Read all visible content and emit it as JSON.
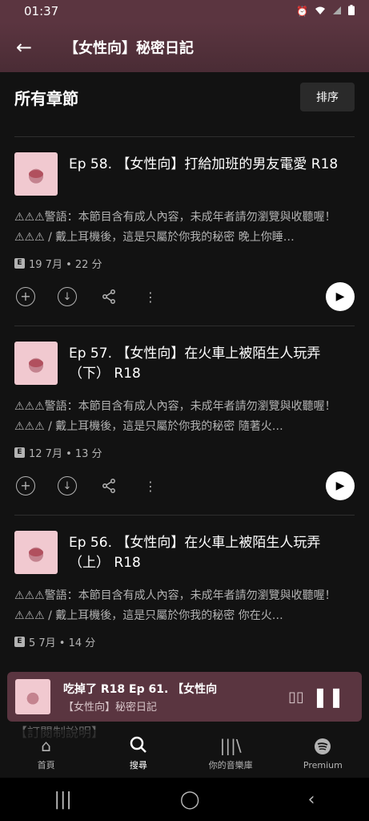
{
  "status": {
    "time": "01:37",
    "icons": [
      "alarm-icon",
      "wifi-icon",
      "signal-icon",
      "battery-icon"
    ]
  },
  "header": {
    "title": "【女性向】秘密日記"
  },
  "section": {
    "title": "所有章節",
    "sort_label": "排序"
  },
  "episodes": [
    {
      "title": "Ep 58. 【女性向】打給加班的男友電愛 R18",
      "description": "⚠⚠⚠警語：本節目含有成人內容，未成年者請勿瀏覽與收聽喔！⚠⚠⚠ / 戴上耳機後，這是只屬於你我的秘密 晚上你睡…",
      "explicit": "E",
      "meta": "19 7月 • 22 分"
    },
    {
      "title": "Ep 57. 【女性向】在火車上被陌生人玩弄（下） R18",
      "description": "⚠⚠⚠警語：本節目含有成人內容，未成年者請勿瀏覽與收聽喔！⚠⚠⚠ / 戴上耳機後，這是只屬於你我的秘密 隨著火…",
      "explicit": "E",
      "meta": "12 7月 • 13 分"
    },
    {
      "title": "Ep 56. 【女性向】在火車上被陌生人玩弄（上） R18",
      "description": "⚠⚠⚠警語：本節目含有成人內容，未成年者請勿瀏覽與收聽喔！⚠⚠⚠ / 戴上耳機後，這是只屬於你我的秘密 你在火…",
      "explicit": "E",
      "meta": "5 7月 • 14 分"
    }
  ],
  "miniplayer": {
    "line1": "吃掉了 R18        Ep 61. 【女性向",
    "line2": "【女性向】秘密日記"
  },
  "peek_text": "【訂閱制說明】",
  "tabs": [
    {
      "label": "首頁",
      "icon": "home-icon"
    },
    {
      "label": "搜尋",
      "icon": "search-icon"
    },
    {
      "label": "你的音樂庫",
      "icon": "library-icon"
    },
    {
      "label": "Premium",
      "icon": "spotify-icon"
    }
  ]
}
